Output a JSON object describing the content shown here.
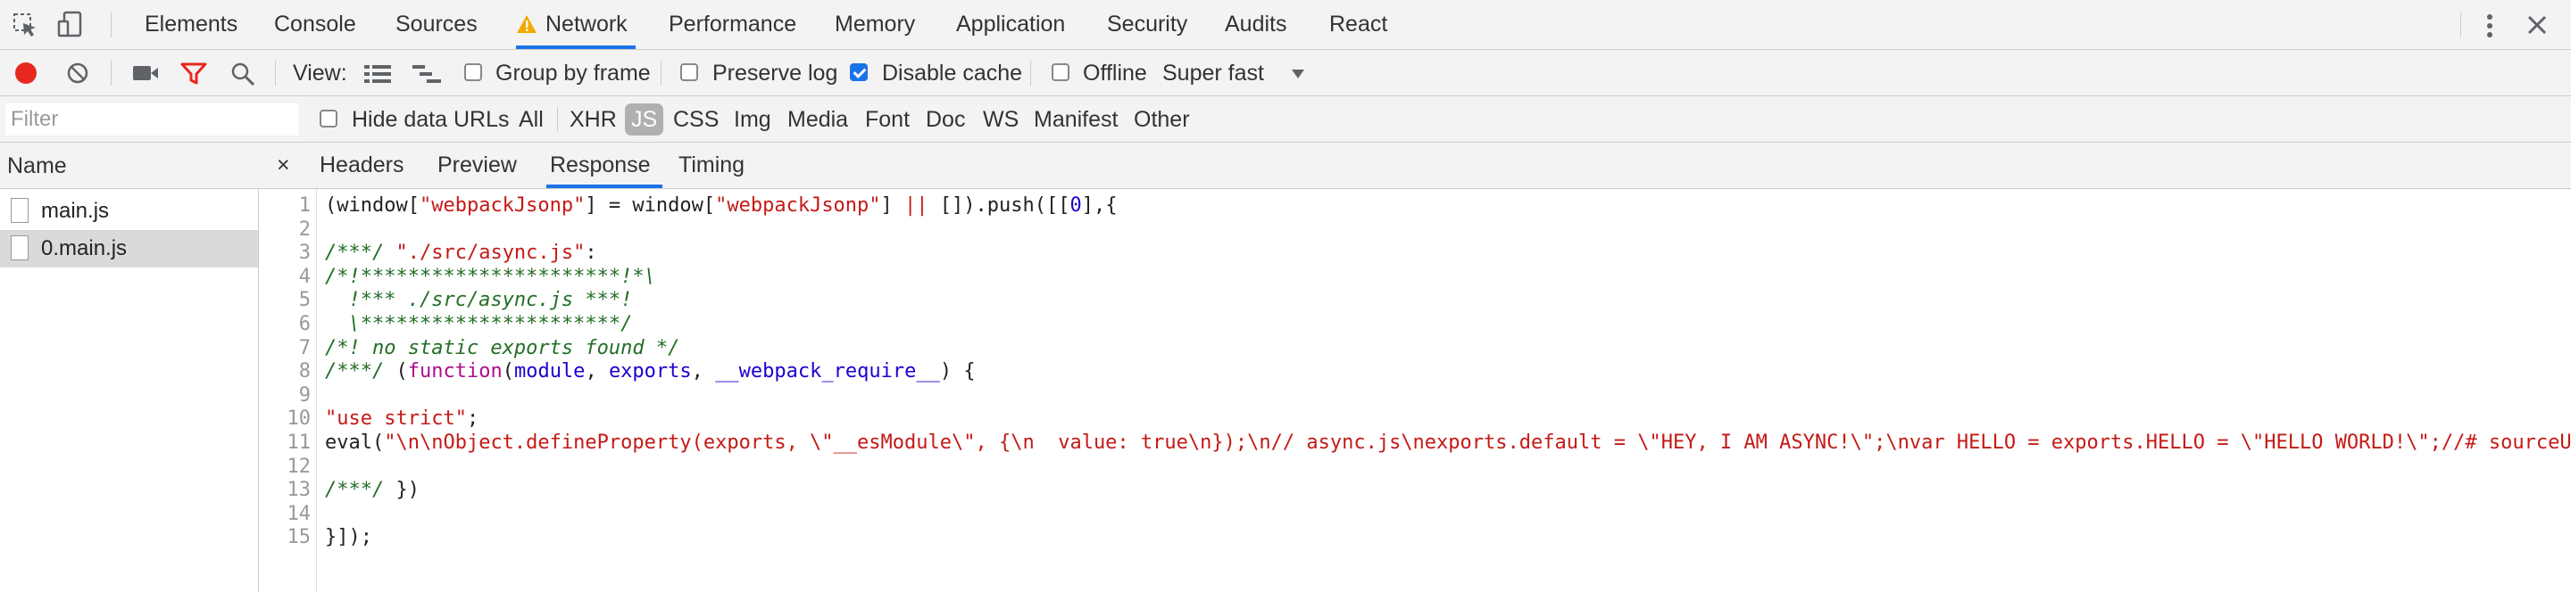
{
  "tabs": [
    "Elements",
    "Console",
    "Sources",
    "Network",
    "Performance",
    "Memory",
    "Application",
    "Security",
    "Audits",
    "React"
  ],
  "active_tab": "Network",
  "toolbar": {
    "view_label": "View:",
    "group_by_frame": "Group by frame",
    "preserve_log": "Preserve log",
    "disable_cache": "Disable cache",
    "offline": "Offline",
    "throttle": "Super fast"
  },
  "filter": {
    "placeholder": "Filter",
    "hide_data_urls": "Hide data URLs",
    "types": [
      "All",
      "XHR",
      "JS",
      "CSS",
      "Img",
      "Media",
      "Font",
      "Doc",
      "WS",
      "Manifest",
      "Other"
    ],
    "active_type": "JS"
  },
  "requests": {
    "header": "Name",
    "items": [
      "main.js",
      "0.main.js"
    ],
    "selected": "0.main.js"
  },
  "detail": {
    "close": "×",
    "tabs": [
      "Headers",
      "Preview",
      "Response",
      "Timing"
    ],
    "active": "Response"
  },
  "code_lines": [
    "(window[\"webpackJsonp\"] = window[\"webpackJsonp\"] || []).push([[0],{",
    "",
    "/***/ \"./src/async.js\":",
    "/*!**********************!*\\",
    "  !*** ./src/async.js ***!",
    "  \\**********************/",
    "/*! no static exports found */",
    "/***/ (function(module, exports, __webpack_require__) {",
    "",
    "\"use strict\";",
    "eval(\"\\n\\nObject.defineProperty(exports, \\\"__esModule\\\", {\\n  value: true\\n});\\n// async.js\\nexports.default = \\\"HEY, I AM ASYNC!\\\";\\nvar HELLO = exports.HELLO = \\\"HELLO WORLD!\\\";//# sourceU",
    "",
    "/***/ })",
    "",
    "}]);"
  ],
  "colors": {
    "accent": "#1a73e8",
    "record": "#e8281e",
    "warning": "#f2a900",
    "filter_active": "#e8281e"
  }
}
